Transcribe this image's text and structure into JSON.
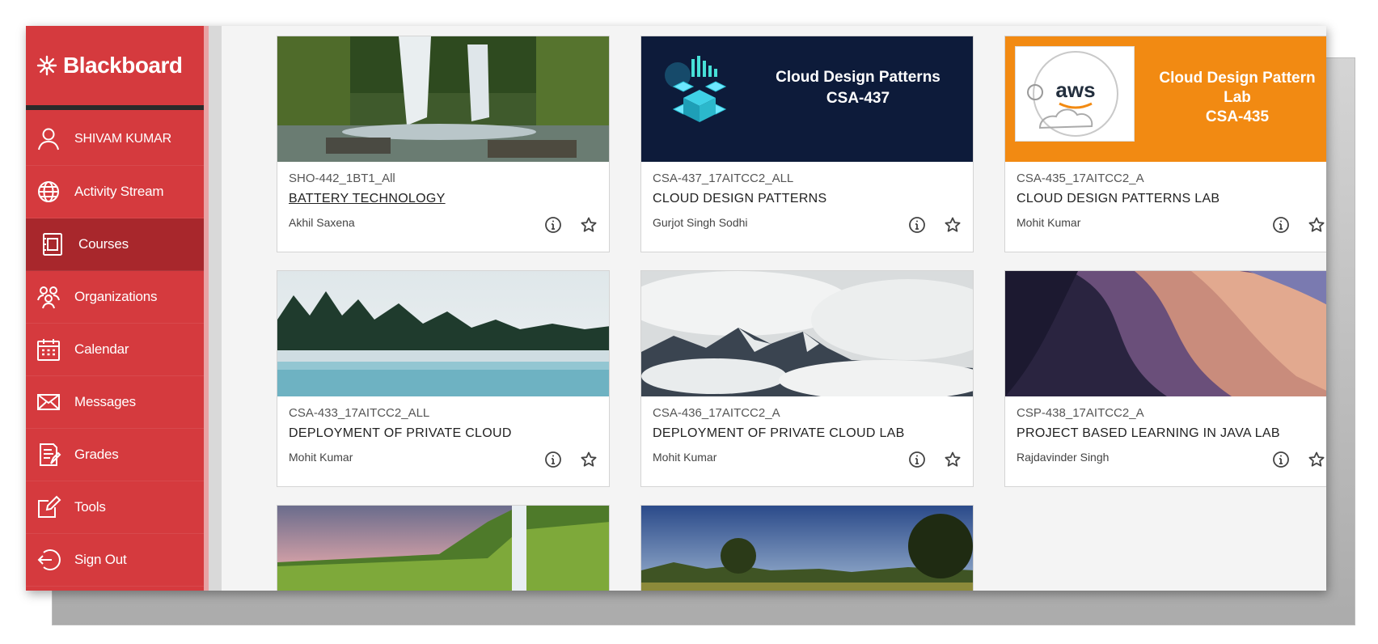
{
  "brand": {
    "name": "Blackboard"
  },
  "sidebar": {
    "items": [
      {
        "label": "SHIVAM KUMAR",
        "icon": "user-icon"
      },
      {
        "label": "Activity Stream",
        "icon": "globe-icon"
      },
      {
        "label": "Courses",
        "icon": "courses-icon",
        "active": true
      },
      {
        "label": "Organizations",
        "icon": "organizations-icon"
      },
      {
        "label": "Calendar",
        "icon": "calendar-icon"
      },
      {
        "label": "Messages",
        "icon": "envelope-icon"
      },
      {
        "label": "Grades",
        "icon": "grades-icon"
      },
      {
        "label": "Tools",
        "icon": "tools-icon"
      },
      {
        "label": "Sign Out",
        "icon": "sign-out-icon"
      }
    ]
  },
  "courses": [
    {
      "code": "SHO-442_1BT1_All",
      "title": "BATTERY TECHNOLOGY",
      "instructor": "Akhil Saxena",
      "image": "waterfall-photo"
    },
    {
      "code": "CSA-437_17AITCC2_ALL",
      "title": "CLOUD DESIGN PATTERNS",
      "instructor": "Gurjot Singh Sodhi",
      "image": "cloud-design-patterns-banner",
      "banner_text": [
        "Cloud Design Patterns",
        "CSA-437"
      ]
    },
    {
      "code": "CSA-435_17AITCC2_A",
      "title": "CLOUD DESIGN PATTERNS LAB",
      "instructor": "Mohit Kumar",
      "image": "aws-banner",
      "banner_text": [
        "Cloud Design Pattern Lab",
        "CSA-435"
      ],
      "logo_text": "aws"
    },
    {
      "code": "CSA-433_17AITCC2_ALL",
      "title": "DEPLOYMENT OF PRIVATE CLOUD",
      "instructor": "Mohit Kumar",
      "image": "misty-lake-photo"
    },
    {
      "code": "CSA-436_17AITCC2_A",
      "title": "DEPLOYMENT OF PRIVATE CLOUD LAB",
      "instructor": "Mohit Kumar",
      "image": "cloudy-mountains-photo"
    },
    {
      "code": "CSP-438_17AITCC2_A",
      "title": "PROJECT BASED LEARNING IN JAVA LAB",
      "instructor": "Rajdavinder Singh",
      "image": "canyon-photo"
    },
    {
      "image": "green-valley-waterfall-photo"
    },
    {
      "image": "sunset-meadow-photo"
    }
  ],
  "colors": {
    "sidebar": "#d53a3e",
    "sidebar_active": "#a8272c",
    "aws_orange": "#f28a12",
    "navy": "#0d1b3a"
  }
}
